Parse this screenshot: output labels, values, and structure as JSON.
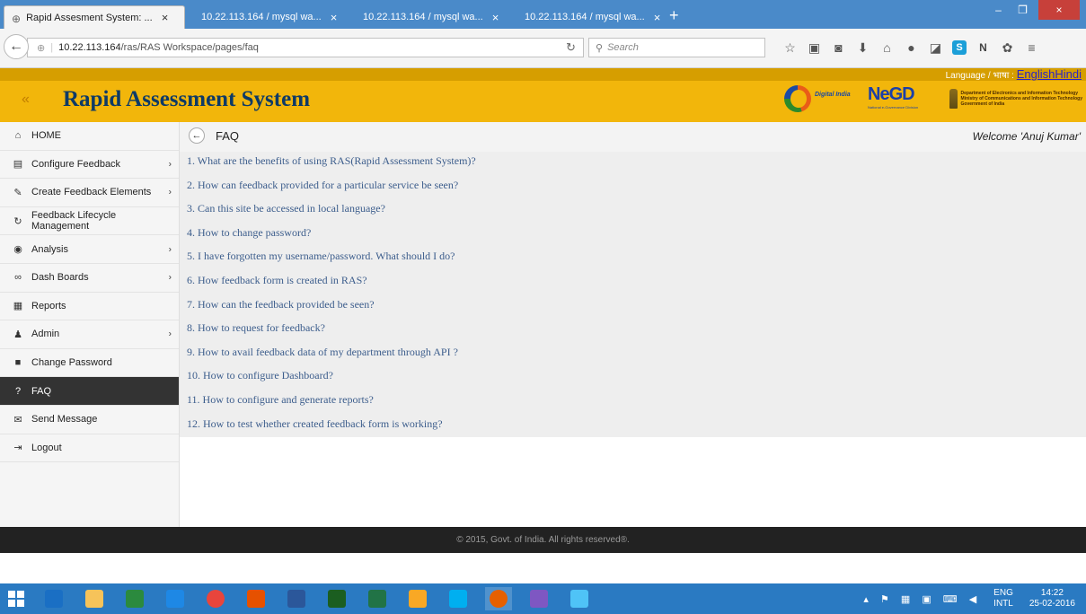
{
  "browser": {
    "tabs": [
      {
        "title": "Rapid Assesment System: ...",
        "favicon": "globe-icon",
        "active": true
      },
      {
        "title": "10.22.113.164 / mysql wa...",
        "favicon": "phpmyadmin-icon",
        "active": false
      },
      {
        "title": "10.22.113.164 / mysql wa...",
        "favicon": "phpmyadmin-icon",
        "active": false
      },
      {
        "title": "10.22.113.164 / mysql wa...",
        "favicon": "phpmyadmin-icon",
        "active": false
      }
    ],
    "close_glyph": "×",
    "new_tab": "+",
    "url_host": "10.22.113.164",
    "url_path": "/ras/RAS Workspace/pages/faq",
    "search_placeholder": "Search",
    "window_controls": {
      "minimize": "–",
      "maximize": "❐",
      "close": "×"
    }
  },
  "app": {
    "language_label": "Language / भाषा :",
    "language_links": "EnglishHindi",
    "title": "Rapid Assessment System",
    "logos": {
      "digital_india": "Digital India",
      "negd": "NeGD",
      "negd_sub": "National e-Governance Division",
      "deity_lines": [
        "Department of Electronics and Information Technology",
        "Ministry of Communications and Information Technology",
        "Government of India"
      ]
    }
  },
  "sidebar": {
    "items": [
      {
        "label": "HOME",
        "icon": "home-icon",
        "glyph": "⌂",
        "chevron": false,
        "active": false
      },
      {
        "label": "Configure Feedback",
        "icon": "file-icon",
        "glyph": "▤",
        "chevron": true,
        "active": false
      },
      {
        "label": "Create Feedback Elements",
        "icon": "pencil-icon",
        "glyph": "✎",
        "chevron": true,
        "active": false
      },
      {
        "label": "Feedback Lifecycle Management",
        "icon": "refresh-icon",
        "glyph": "↻",
        "chevron": false,
        "active": false
      },
      {
        "label": "Analysis",
        "icon": "globe-icon",
        "glyph": "◉",
        "chevron": true,
        "active": false
      },
      {
        "label": "Dash Boards",
        "icon": "binoculars-icon",
        "glyph": "∞",
        "chevron": true,
        "active": false
      },
      {
        "label": "Reports",
        "icon": "report-icon",
        "glyph": "▦",
        "chevron": false,
        "active": false
      },
      {
        "label": "Admin",
        "icon": "user-icon",
        "glyph": "♟",
        "chevron": true,
        "active": false
      },
      {
        "label": "Change Password",
        "icon": "lock-icon",
        "glyph": "■",
        "chevron": false,
        "active": false
      },
      {
        "label": "FAQ",
        "icon": "question-icon",
        "glyph": "?",
        "chevron": false,
        "active": true
      },
      {
        "label": "Send Message",
        "icon": "envelope-icon",
        "glyph": "✉",
        "chevron": false,
        "active": false
      },
      {
        "label": "Logout",
        "icon": "logout-icon",
        "glyph": "⇥",
        "chevron": false,
        "active": false
      }
    ],
    "chevron_glyph": "›"
  },
  "main": {
    "breadcrumb": "FAQ",
    "welcome": "Welcome 'Anuj Kumar'",
    "faqs": [
      "1. What are the benefits of using RAS(Rapid Assessment System)?",
      "2. How can feedback provided for a particular service be seen?",
      "3. Can this site be accessed in local language?",
      "4. How to change password?",
      "5. I have forgotten my username/password. What should I do?",
      "6. How feedback form is created in RAS?",
      "7. How can the feedback provided be seen?",
      "8. How to request for feedback?",
      "9. How to avail feedback data of my department through API ?",
      "10. How to configure Dashboard?",
      "11. How to configure and generate reports?",
      "12. How to test whether created feedback form is working?"
    ]
  },
  "footer": {
    "text": "© 2015, Govt. of India. All rights reserved®."
  },
  "taskbar": {
    "apps": [
      "ie-icon",
      "file-explorer-icon",
      "store-icon",
      "app-icon",
      "chrome-icon",
      "office-icon",
      "word-icon",
      "app-icon-2",
      "excel-icon",
      "apps-icon",
      "skype-icon",
      "firefox-icon",
      "paint-icon",
      "app-icon-3"
    ],
    "language_top": "ENG",
    "language_bottom": "INTL",
    "time": "14:22",
    "date": "25-02-2016"
  },
  "colors": {
    "header_yellow": "#f2b60b",
    "title_navy": "#0e3a66",
    "faq_link": "#3c5d8c",
    "sidebar_active": "#333333",
    "taskbar_blue": "#2a7ac2"
  }
}
